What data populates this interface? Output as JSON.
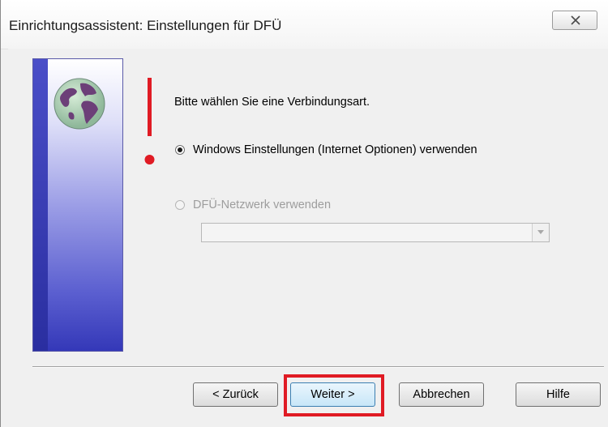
{
  "window": {
    "title": "Einrichtungsassistent: Einstellungen für DFÜ"
  },
  "content": {
    "prompt": "Bitte wählen Sie eine Verbindungsart.",
    "options": [
      {
        "label": "Windows Einstellungen (Internet Optionen) verwenden",
        "checked": true,
        "enabled": true
      },
      {
        "label": "DFÜ-Netzwerk verwenden",
        "checked": false,
        "enabled": false
      }
    ],
    "dropdown": {
      "value": ""
    }
  },
  "buttons": {
    "back": "< Zurück",
    "next": "Weiter >",
    "cancel": "Abbrechen",
    "help": "Hilfe"
  },
  "colors": {
    "highlight": "#e01b24",
    "alert": "#e01b24",
    "sidebar_dark": "#3438b8"
  },
  "icons": {
    "close": "close-icon",
    "globe": "globe-icon",
    "alert": "exclamation-icon",
    "dropdown": "chevron-down-icon"
  }
}
